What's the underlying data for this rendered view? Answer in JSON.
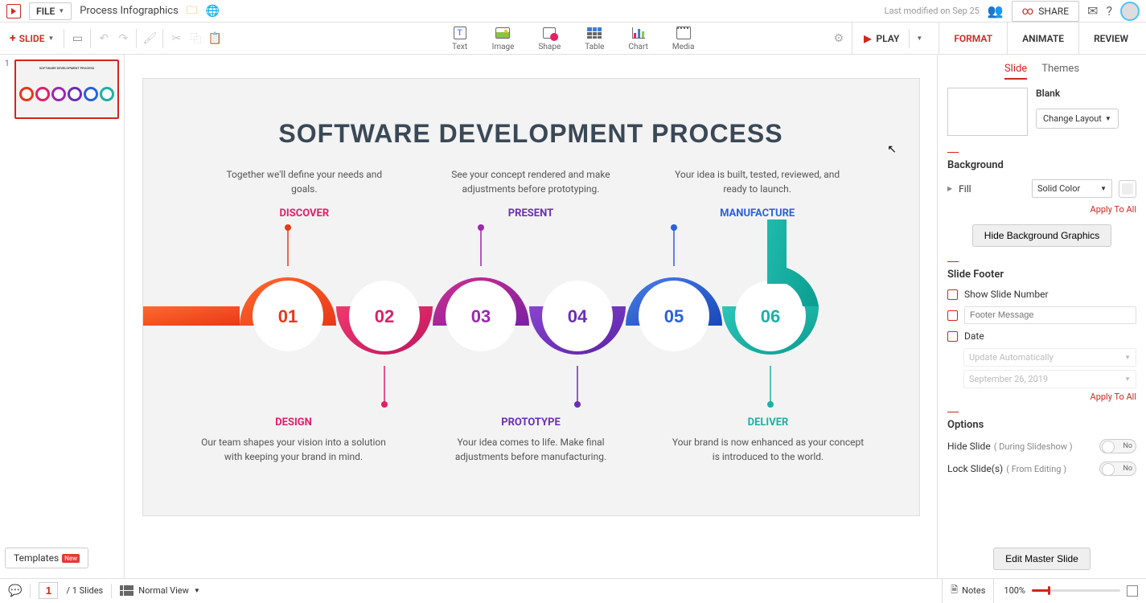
{
  "topbar": {
    "file_label": "FILE",
    "doc_title": "Process Infographics",
    "last_modified": "Last modified on Sep 25",
    "share": "SHARE"
  },
  "toolbar": {
    "slide": "SLIDE",
    "tools": {
      "text": "Text",
      "image": "Image",
      "shape": "Shape",
      "table": "Table",
      "chart": "Chart",
      "media": "Media"
    },
    "play": "PLAY",
    "tabs": {
      "format": "FORMAT",
      "animate": "ANIMATE",
      "review": "REVIEW"
    }
  },
  "thumb": {
    "num": "1",
    "templates": "Templates",
    "badge": "New"
  },
  "slide": {
    "title": "SOFTWARE DEVELOPMENT PROCESS",
    "top_descs": [
      "Together we'll define your needs and goals.",
      "See your concept rendered and make adjustments before prototyping.",
      "Your idea is built, tested, reviewed, and ready to launch."
    ],
    "stages_top": [
      "DISCOVER",
      "PRESENT",
      "MANUFACTURE"
    ],
    "nums": [
      "01",
      "02",
      "03",
      "04",
      "05",
      "06"
    ],
    "stages_bottom": [
      "DESIGN",
      "PROTOTYPE",
      "DELIVER"
    ],
    "bottom_descs": [
      "Our team shapes your vision into a solution with keeping your brand in mind.",
      "Your idea comes to life. Make final adjustments before manufacturing.",
      "Your brand is now enhanced as your concept is introduced to the world."
    ],
    "colors": {
      "c1": "#e8381a",
      "c2": "#e01f68",
      "c3": "#9c27b0",
      "c4": "#6a2fb5",
      "c5": "#2962d9",
      "c6": "#1cb1a6"
    }
  },
  "panel": {
    "sub_tabs": {
      "slide": "Slide",
      "themes": "Themes"
    },
    "layout_name": "Blank",
    "change_layout": "Change Layout",
    "background": "Background",
    "fill": "Fill",
    "fill_type": "Solid Color",
    "apply_all": "Apply To All",
    "hide_bg": "Hide Background Graphics",
    "slide_footer": "Slide Footer",
    "show_num": "Show Slide Number",
    "footer_placeholder": "Footer Message",
    "date": "Date",
    "date_mode": "Update Automatically",
    "date_value": "September 26, 2019",
    "options": "Options",
    "hide_slide": "Hide Slide",
    "hide_slide_sub": "( During Slideshow )",
    "lock_slide": "Lock Slide(s)",
    "lock_slide_sub": "( From Editing )",
    "toggle_no": "No",
    "edit_master": "Edit Master Slide"
  },
  "status": {
    "page": "1",
    "total": "/  1 Slides",
    "view": "Normal View",
    "notes": "Notes",
    "zoom": "100%"
  }
}
